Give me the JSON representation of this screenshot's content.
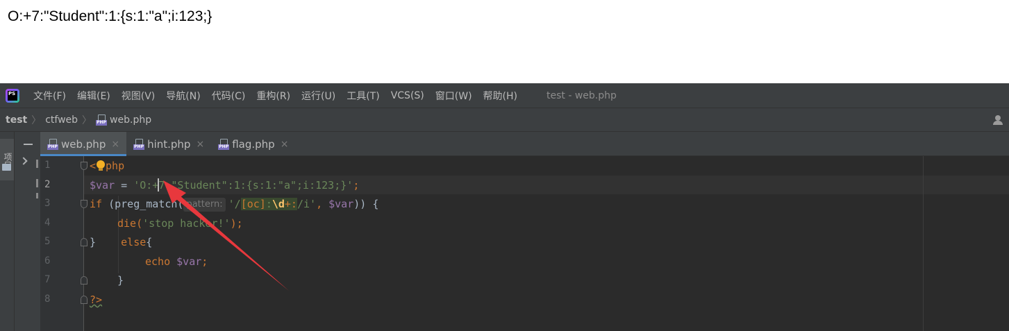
{
  "browser_output": {
    "text": "O:+7:\"Student\":1:{s:1:\"a\";i:123;}"
  },
  "ide": {
    "logo": {
      "label": "PS",
      "icon": "phpstorm-logo-icon"
    },
    "menu": [
      "文件(F)",
      "编辑(E)",
      "视图(V)",
      "导航(N)",
      "代码(C)",
      "重构(R)",
      "运行(U)",
      "工具(T)",
      "VCS(S)",
      "窗口(W)",
      "帮助(H)"
    ],
    "window_title": "test - web.php",
    "breadcrumb": {
      "project": "test",
      "folder": "ctfweb",
      "file": "web.php"
    },
    "file_badge": "PHP",
    "tool_window": {
      "label": "项目"
    },
    "tabs": [
      {
        "label": "web.php",
        "active": true,
        "close": "×"
      },
      {
        "label": "hint.php",
        "active": false,
        "close": "×"
      },
      {
        "label": "flag.php",
        "active": false,
        "close": "×"
      }
    ],
    "line_numbers": [
      "1",
      "2",
      "3",
      "4",
      "5",
      "6",
      "7",
      "8"
    ],
    "current_line": "2",
    "code": {
      "l1_open": "<",
      "l1_rest": "php",
      "l2_var": "$var",
      "l2_eq": " = ",
      "l2_str_a": "'O:+",
      "l2_str_b": "7:\"Student\":1:{s:1:\"a\";i:123;}'",
      "l2_semi": ";",
      "l3_if": "if",
      "l3_call": " (preg_match(",
      "l3_hint": "pattern:",
      "l3_q1": "'/",
      "l3_cls": "[oc]",
      "l3_colon": ":",
      "l3_d": "\\d",
      "l3_plus": "+:",
      "l3_tail": "/i'",
      "l3_comma": ", ",
      "l3_var": "$var",
      "l3_end": ")) {",
      "l4_die": "die(",
      "l4_str": "'stop hacker!'",
      "l4_end": ");",
      "l5_brace": "}",
      "l5_else": "    else",
      "l5_open": "{",
      "l6_echo": "echo ",
      "l6_var": "$var",
      "l6_semi": ";",
      "l7_brace": "}",
      "l8_close": "?>"
    },
    "colors": {
      "keyword": "#cc7832",
      "variable": "#9876aa",
      "string": "#6a8759",
      "annotation_arrow": "#e8383d"
    }
  }
}
